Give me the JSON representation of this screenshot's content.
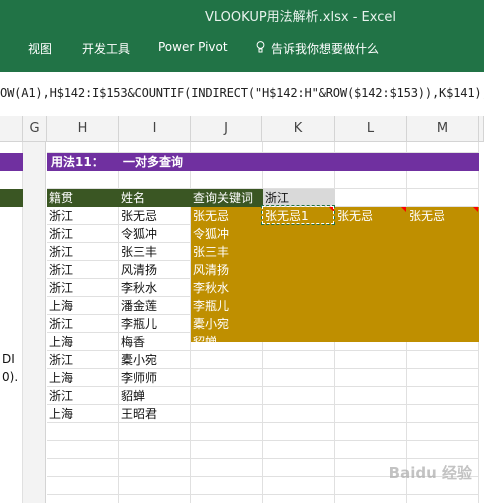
{
  "window": {
    "title": "VLOOKUP用法解析.xlsx  -  Excel"
  },
  "ribbon": {
    "tabs": [
      "视图",
      "开发工具",
      "Power Pivot"
    ],
    "tell_me": "告诉我你想要做什么"
  },
  "formula_bar": {
    "text": "OW(A1),H$142:I$153&COUNTIF(INDIRECT(\"H$142:H\"&ROW($142:$153)),K$141),"
  },
  "columns": [
    "G",
    "H",
    "I",
    "J",
    "K",
    "L",
    "M"
  ],
  "sheet": {
    "section_title": "用法11：",
    "section_subtitle": "一对多查询",
    "headers": {
      "h": "籍贯",
      "i": "姓名",
      "j": "查询关键词",
      "k": "浙江"
    },
    "rows": [
      {
        "h": "浙江",
        "i": "张无忌"
      },
      {
        "h": "浙江",
        "i": "令狐冲"
      },
      {
        "h": "浙江",
        "i": "张三丰"
      },
      {
        "h": "浙江",
        "i": "风清扬"
      },
      {
        "h": "浙江",
        "i": "李秋水"
      },
      {
        "h": "上海",
        "i": "潘金莲"
      },
      {
        "h": "浙江",
        "i": "李瓶儿"
      },
      {
        "h": "上海",
        "i": "梅香"
      },
      {
        "h": "浙江",
        "i": "橐小宛"
      },
      {
        "h": "上海",
        "i": "李师师"
      },
      {
        "h": "浙江",
        "i": "貂蝉"
      },
      {
        "h": "上海",
        "i": "王昭君"
      }
    ],
    "results_j": [
      "张无忌",
      "令狐冲",
      "张三丰",
      "风清扬",
      "李秋水",
      "李瓶儿",
      "橐小宛",
      "貂蝉"
    ],
    "results_row1": {
      "k": "张无忌1",
      "l": "张无忌",
      "m": "张无忌"
    },
    "left_fragments": [
      "DI",
      "0)."
    ]
  },
  "watermark": "Baidu 经验",
  "colors": {
    "excel_green": "#217346",
    "purple": "#7030a0",
    "dark_green": "#3a5623",
    "gold": "#bf8f00"
  }
}
